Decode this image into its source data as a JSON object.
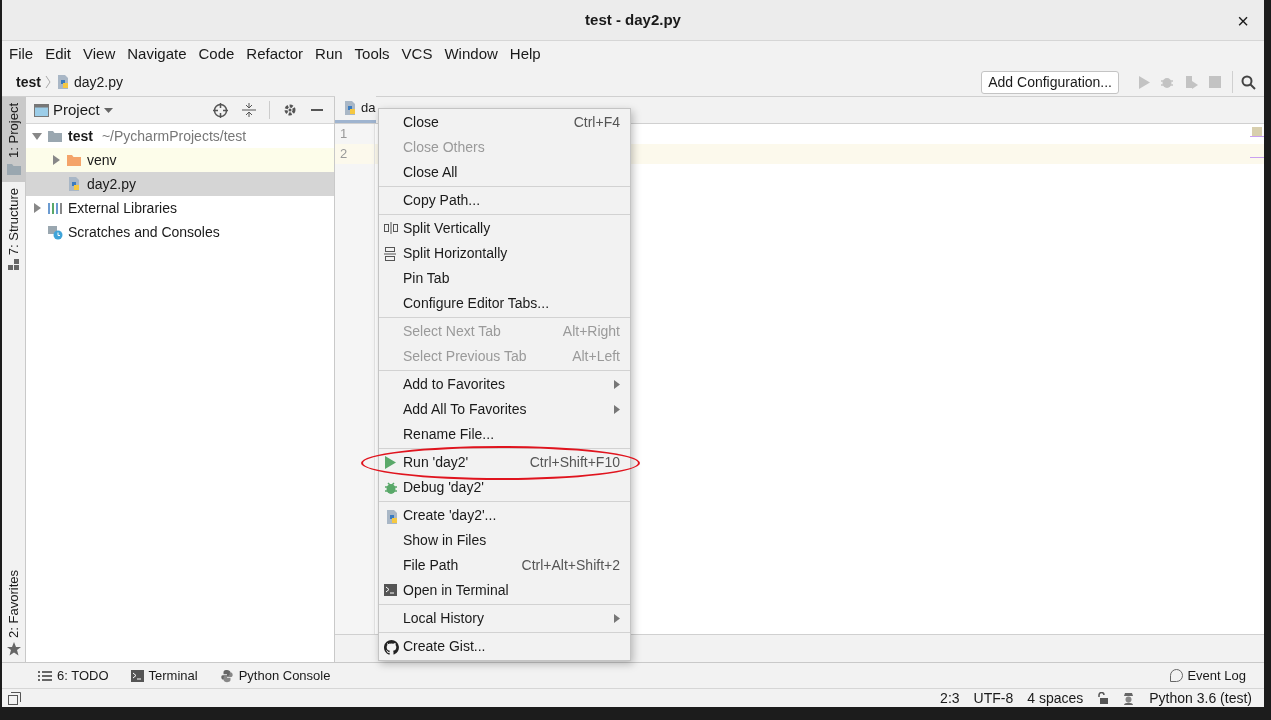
{
  "window": {
    "title": "test - day2.py",
    "close": "×"
  },
  "menu_bar": [
    "File",
    "Edit",
    "View",
    "Navigate",
    "Code",
    "Refactor",
    "Run",
    "Tools",
    "VCS",
    "Window",
    "Help"
  ],
  "breadcrumbs": [
    {
      "label": "test",
      "kind": "project"
    },
    {
      "label": "day2.py",
      "kind": "python"
    }
  ],
  "toolbar": {
    "config_button": "Add Configuration..."
  },
  "left_strip": [
    {
      "label": "1: Project",
      "kind": "folder",
      "selected": true
    },
    {
      "label": "7: Structure",
      "kind": "structure",
      "selected": false
    },
    {
      "label": "2: Favorites",
      "kind": "star",
      "selected": false
    }
  ],
  "project_panel": {
    "title": "Project",
    "tree": [
      {
        "label": "test",
        "hint": "~/PycharmProjects/test",
        "kind": "folder",
        "expanded": true,
        "selected": false,
        "hovered": false,
        "children": [
          {
            "label": "venv",
            "kind": "venv",
            "expanded": false,
            "selected": false,
            "hovered": true
          },
          {
            "label": "day2.py",
            "kind": "python",
            "selected": true,
            "hovered": false
          }
        ]
      },
      {
        "label": "External Libraries",
        "kind": "libraries",
        "expanded": false,
        "selected": false,
        "hovered": false
      },
      {
        "label": "Scratches and Consoles",
        "kind": "scratches",
        "selected": false,
        "hovered": false
      }
    ]
  },
  "editor": {
    "tab": {
      "label": "da"
    },
    "line_numbers": [
      "1",
      "2"
    ]
  },
  "context_menu": [
    [
      {
        "label": "Close",
        "shortcut": "Ctrl+F4",
        "kind": "plain",
        "disabled": false,
        "submenu": false,
        "highlighted": false
      },
      {
        "label": "Close Others",
        "kind": "plain",
        "disabled": true,
        "submenu": false,
        "highlighted": false
      },
      {
        "label": "Close All",
        "kind": "plain",
        "disabled": false,
        "submenu": false,
        "highlighted": false
      }
    ],
    [
      {
        "label": "Copy Path...",
        "kind": "plain",
        "disabled": false,
        "submenu": false,
        "highlighted": false
      }
    ],
    [
      {
        "label": "Split Vertically",
        "kind": "split-v",
        "disabled": false,
        "submenu": false,
        "highlighted": false
      },
      {
        "label": "Split Horizontally",
        "kind": "split-h",
        "disabled": false,
        "submenu": false,
        "highlighted": false
      },
      {
        "label": "Pin Tab",
        "kind": "plain",
        "disabled": false,
        "submenu": false,
        "highlighted": false
      },
      {
        "label": "Configure Editor Tabs...",
        "kind": "plain",
        "disabled": false,
        "submenu": false,
        "highlighted": false
      }
    ],
    [
      {
        "label": "Select Next Tab",
        "shortcut": "Alt+Right",
        "kind": "plain",
        "disabled": true,
        "submenu": false,
        "highlighted": false
      },
      {
        "label": "Select Previous Tab",
        "shortcut": "Alt+Left",
        "kind": "plain",
        "disabled": true,
        "submenu": false,
        "highlighted": false
      }
    ],
    [
      {
        "label": "Add to Favorites",
        "kind": "plain",
        "disabled": false,
        "submenu": true,
        "highlighted": false
      },
      {
        "label": "Add All To Favorites",
        "kind": "plain",
        "disabled": false,
        "submenu": true,
        "highlighted": false
      },
      {
        "label": "Rename File...",
        "kind": "plain",
        "disabled": false,
        "submenu": false,
        "highlighted": false
      }
    ],
    [
      {
        "label": "Run 'day2'",
        "shortcut": "Ctrl+Shift+F10",
        "kind": "play",
        "disabled": false,
        "submenu": false,
        "highlighted": true
      },
      {
        "label": "Debug 'day2'",
        "kind": "bug",
        "disabled": false,
        "submenu": false,
        "highlighted": false
      }
    ],
    [
      {
        "label": "Create 'day2'...",
        "kind": "python",
        "disabled": false,
        "submenu": false,
        "highlighted": false
      },
      {
        "label": "Show in Files",
        "kind": "plain",
        "disabled": false,
        "submenu": false,
        "highlighted": false
      },
      {
        "label": "File Path",
        "shortcut": "Ctrl+Alt+Shift+2",
        "kind": "plain",
        "disabled": false,
        "submenu": false,
        "highlighted": false
      },
      {
        "label": "Open in Terminal",
        "kind": "terminal",
        "disabled": false,
        "submenu": false,
        "highlighted": false
      }
    ],
    [
      {
        "label": "Local History",
        "kind": "plain",
        "disabled": false,
        "submenu": true,
        "highlighted": false
      }
    ],
    [
      {
        "label": "Create Gist...",
        "kind": "github",
        "disabled": false,
        "submenu": false,
        "highlighted": false
      }
    ]
  ],
  "bottom_tools": [
    {
      "label": "6: TODO",
      "kind": "list"
    },
    {
      "label": "Terminal",
      "kind": "terminal"
    },
    {
      "label": "Python Console",
      "kind": "python"
    }
  ],
  "event_log": "Event Log",
  "status_bar": {
    "position": "2:3",
    "encoding": "UTF-8",
    "indent": "4 spaces",
    "interpreter": "Python 3.6 (test)"
  }
}
